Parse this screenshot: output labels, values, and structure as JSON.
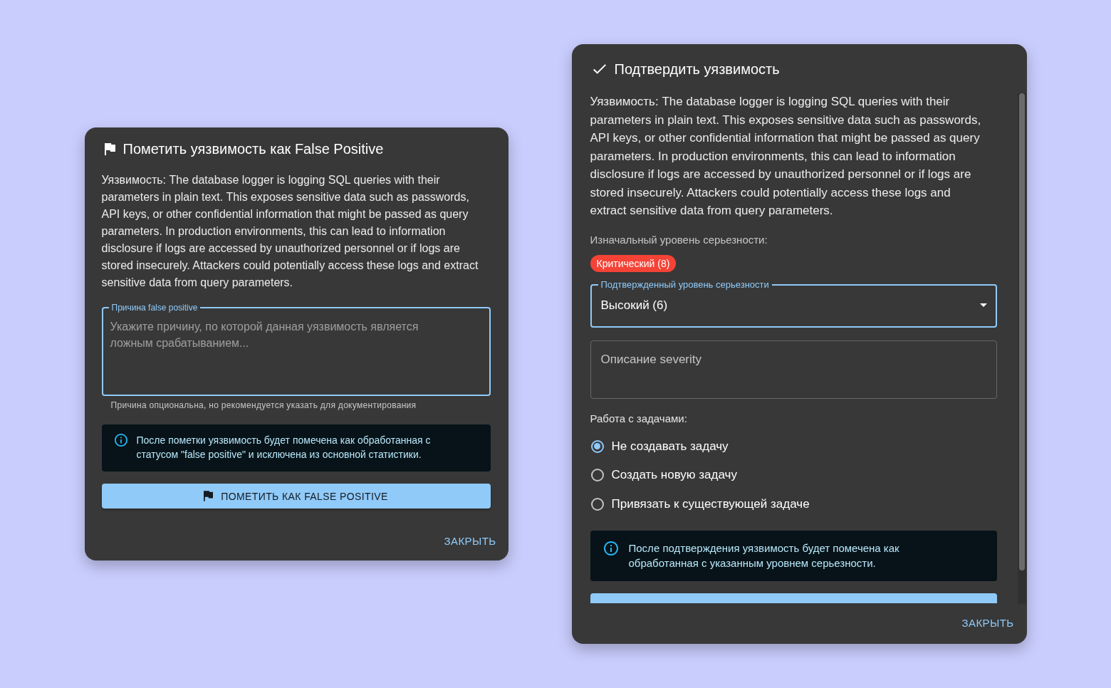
{
  "false_positive_dialog": {
    "title": "Пометить уязвимость как False Positive",
    "description": "Уязвимость: The database logger is logging SQL queries with their parameters in plain text. This exposes sensitive data such as passwords, API keys, or other confidential information that might be passed as query parameters. In production environments, this can lead to information disclosure if logs are accessed by unauthorized personnel or if logs are stored insecurely. Attackers could potentially access these logs and extract sensitive data from query parameters.",
    "reason_field": {
      "label": "Причина false positive",
      "placeholder": "Укажите причину, по которой данная уязвимость является ложным срабатыванием...",
      "helper_text": "Причина опциональна, но рекомендуется указать для документирования",
      "focused": true
    },
    "info_alert": {
      "text": "После пометки уязвимость будет помечена как обработанная с статусом \"false positive\" и исключена из основной статистики."
    },
    "submit_button": {
      "label": "ПОМЕТИТЬ КАК FALSE POSITIVE"
    },
    "close_button": {
      "label": "ЗАКРЫТЬ"
    }
  },
  "confirm_dialog": {
    "title": "Подтвердить уязвимость",
    "description": "Уязвимость: The database logger is logging SQL queries with their parameters in plain text. This exposes sensitive data such as passwords, API keys, or other confidential information that might be passed as query parameters. In production environments, this can lead to information disclosure if logs are accessed by unauthorized personnel or if logs are stored insecurely. Attackers could potentially access these logs and extract sensitive data from query parameters.",
    "original_severity": {
      "label": "Изначальный уровень серьезности:",
      "chip": "Критический (8)"
    },
    "confirmed_severity": {
      "label": "Подтвержденный уровень серьезности",
      "value": "Высокий (6)",
      "focused": true
    },
    "severity_description": {
      "placeholder": "Описание severity",
      "focused": false
    },
    "tasks": {
      "label": "Работа с задачами:",
      "options": [
        {
          "label": "Не создавать задачу",
          "selected": true
        },
        {
          "label": "Создать новую задачу",
          "selected": false
        },
        {
          "label": "Привязать к существующей задаче",
          "selected": false
        }
      ]
    },
    "info_alert": {
      "text": "После подтверждения уязвимость будет помечена как обработанная с указанным уровнем серьезности."
    },
    "close_button": {
      "label": "ЗАКРЫТЬ"
    }
  }
}
